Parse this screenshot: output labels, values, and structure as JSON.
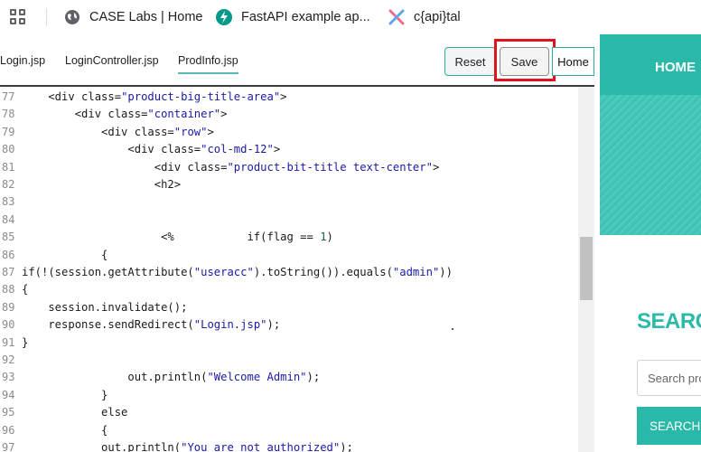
{
  "bookmarks": [
    {
      "label": "CASE Labs | Home",
      "icon": "globe-icon"
    },
    {
      "label": "FastAPI example ap...",
      "icon": "fastapi-icon"
    },
    {
      "label": "c{api}tal",
      "icon": "capital-x-icon"
    }
  ],
  "tabs": [
    {
      "label": "Login.jsp"
    },
    {
      "label": "LoginController.jsp"
    },
    {
      "label": "ProdInfo.jsp",
      "active": true
    }
  ],
  "toolbar": {
    "reset_label": "Reset",
    "save_label": "Save",
    "home_label": "Home"
  },
  "code_lines": [
    {
      "num": "77",
      "text": "    <div class=\"product-big-title-area\">"
    },
    {
      "num": "78",
      "text": "        <div class=\"container\">"
    },
    {
      "num": "79",
      "text": "            <div class=\"row\">"
    },
    {
      "num": "80",
      "text": "                <div class=\"col-md-12\">"
    },
    {
      "num": "81",
      "text": "                    <div class=\"product-bit-title text-center\">"
    },
    {
      "num": "82",
      "text": "                    <h2>"
    },
    {
      "num": "83",
      "text": ""
    },
    {
      "num": "84",
      "text": ""
    },
    {
      "num": "85",
      "text": "                     <%           if(flag == 1)"
    },
    {
      "num": "86",
      "text": "            {"
    },
    {
      "num": "87",
      "text": "if(!(session.getAttribute(\"useracc\").toString()).equals(\"admin\"))"
    },
    {
      "num": "88",
      "text": "{"
    },
    {
      "num": "89",
      "text": "    session.invalidate();"
    },
    {
      "num": "90",
      "text": "    response.sendRedirect(\"Login.jsp\");"
    },
    {
      "num": "91",
      "text": "}"
    },
    {
      "num": "92",
      "text": ""
    },
    {
      "num": "93",
      "text": "                out.println(\"Welcome Admin\");"
    },
    {
      "num": "94",
      "text": "            }"
    },
    {
      "num": "95",
      "text": "            else"
    },
    {
      "num": "96",
      "text": "            {"
    },
    {
      "num": "97",
      "text": "            out.println(\"You are not authorized\");"
    }
  ],
  "preview": {
    "nav_home": "HOME",
    "search_title": "SEARCH",
    "search_placeholder": "Search products...",
    "search_button": "SEARCH"
  },
  "colors": {
    "accent": "#2ab8a8",
    "highlight": "#e0141e",
    "string": "#1a1aa6"
  }
}
